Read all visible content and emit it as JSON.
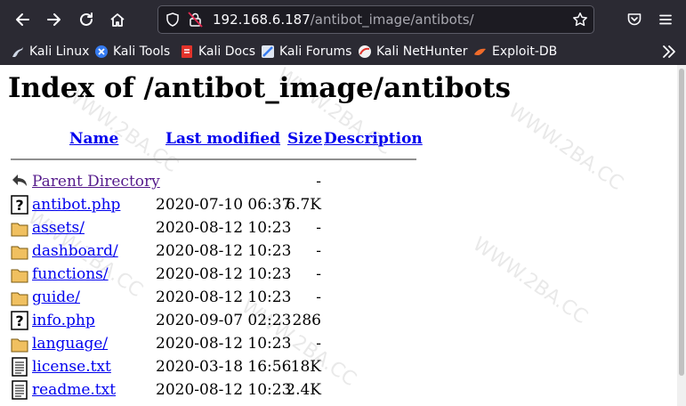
{
  "browser": {
    "url_host": "192.168.6.187",
    "url_path": "/antibot_image/antibots/",
    "bookmarks": [
      {
        "label": "Kali Linux",
        "icon": "kali-dragon-icon"
      },
      {
        "label": "Kali Tools",
        "icon": "kali-tools-icon"
      },
      {
        "label": "Kali Docs",
        "icon": "kali-docs-icon"
      },
      {
        "label": "Kali Forums",
        "icon": "kali-forums-icon"
      },
      {
        "label": "Kali NetHunter",
        "icon": "kali-nethunter-icon"
      },
      {
        "label": "Exploit-DB",
        "icon": "exploit-db-icon"
      }
    ]
  },
  "page": {
    "title": "Index of /antibot_image/antibots",
    "columns": {
      "name": "Name",
      "modified": "Last modified",
      "size": "Size",
      "description": "Description"
    },
    "rows": [
      {
        "name": "Parent Directory",
        "date": "",
        "size": "-",
        "icon": "back-icon"
      },
      {
        "name": "antibot.php",
        "date": "2020-07-10 06:37",
        "size": "6.7K",
        "icon": "unknown-file-icon"
      },
      {
        "name": "assets/",
        "date": "2020-08-12 10:23",
        "size": "-",
        "icon": "folder-icon"
      },
      {
        "name": "dashboard/",
        "date": "2020-08-12 10:23",
        "size": "-",
        "icon": "folder-icon"
      },
      {
        "name": "functions/",
        "date": "2020-08-12 10:23",
        "size": "-",
        "icon": "folder-icon"
      },
      {
        "name": "guide/",
        "date": "2020-08-12 10:23",
        "size": "-",
        "icon": "folder-icon"
      },
      {
        "name": "info.php",
        "date": "2020-09-07 02:23",
        "size": "286",
        "icon": "unknown-file-icon"
      },
      {
        "name": "language/",
        "date": "2020-08-12 10:23",
        "size": "-",
        "icon": "folder-icon"
      },
      {
        "name": "license.txt",
        "date": "2020-03-18 16:56",
        "size": "18K",
        "icon": "text-file-icon"
      },
      {
        "name": "readme.txt",
        "date": "2020-08-12 10:23",
        "size": "2.4K",
        "icon": "text-file-icon"
      }
    ]
  },
  "watermark": "WWW.2BA.CC"
}
